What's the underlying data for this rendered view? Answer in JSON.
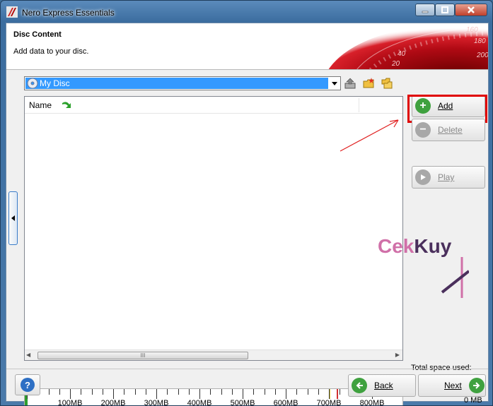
{
  "window": {
    "title": "Nero Express Essentials"
  },
  "header": {
    "title": "Disc Content",
    "subtitle": "Add data to your disc."
  },
  "speedometer_numbers": [
    "160",
    "180",
    "40",
    "20",
    "200"
  ],
  "disc_selector": {
    "selected": "My Disc"
  },
  "list": {
    "column_name": "Name",
    "scroll_thumb_grip": "III"
  },
  "side_buttons": {
    "add": "Add",
    "delete": "Delete",
    "play": "Play"
  },
  "watermark": {
    "part1": "Cek",
    "part2": "Kuy"
  },
  "space": {
    "label": "Total space used:",
    "value": "0 MB"
  },
  "ruler": {
    "labels": [
      "100MB",
      "200MB",
      "300MB",
      "400MB",
      "500MB",
      "600MB",
      "700MB",
      "800MB"
    ],
    "used_fraction": 0.0
  },
  "nav": {
    "back": "Back",
    "next": "Next"
  },
  "colors": {
    "accent_red": "#e00000",
    "selection_blue": "#3399ff",
    "green_button": "#3fa13f"
  }
}
